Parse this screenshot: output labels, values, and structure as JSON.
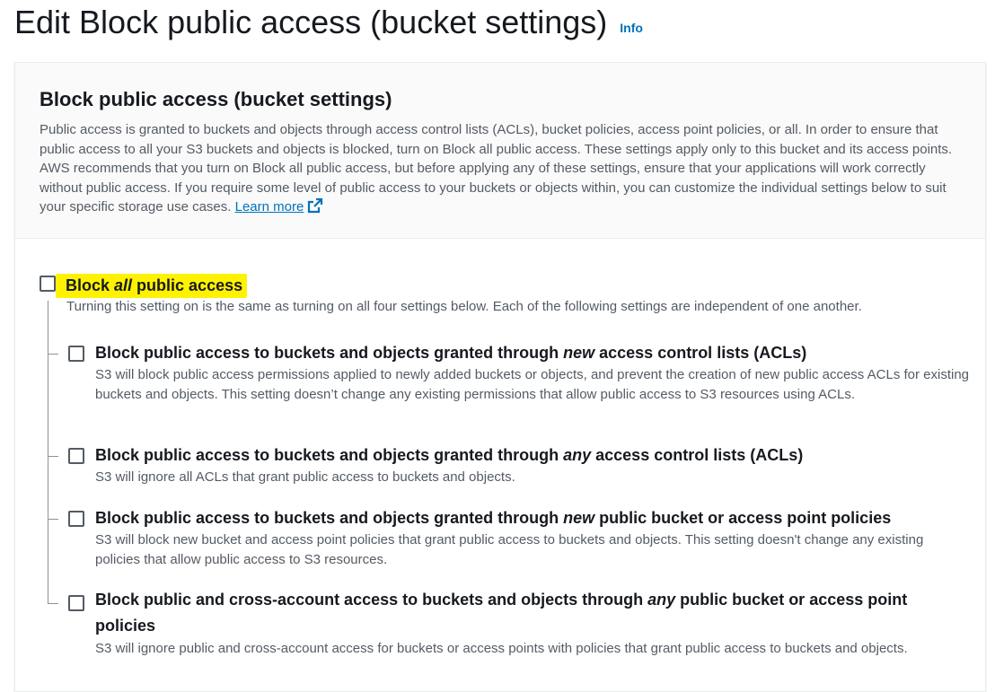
{
  "header": {
    "title": "Edit Block public access (bucket settings)",
    "info_label": "Info"
  },
  "panel": {
    "title": "Block public access (bucket settings)",
    "description": "Public access is granted to buckets and objects through access control lists (ACLs), bucket policies, access point policies, or all. In order to ensure that public access to all your S3 buckets and objects is blocked, turn on Block all public access. These settings apply only to this bucket and its access points. AWS recommends that you turn on Block all public access, but before applying any of these settings, ensure that your applications will work correctly without public access. If you require some level of public access to your buckets or objects within, you can customize the individual settings below to suit your specific storage use cases.",
    "learn_more": "Learn more"
  },
  "block_all": {
    "label_prefix": "Block ",
    "label_emph": "all",
    "label_suffix": " public access",
    "checked": false,
    "description": "Turning this setting on is the same as turning on all four settings below. Each of the following settings are independent of one another."
  },
  "options": [
    {
      "label_prefix": "Block public access to buckets and objects granted through ",
      "label_emph": "new",
      "label_suffix": " access control lists (ACLs)",
      "checked": false,
      "description": "S3 will block public access permissions applied to newly added buckets or objects, and prevent the creation of new public access ACLs for existing buckets and objects. This setting doesn’t change any existing permissions that allow public access to S3 resources using ACLs."
    },
    {
      "label_prefix": "Block public access to buckets and objects granted through ",
      "label_emph": "any",
      "label_suffix": " access control lists (ACLs)",
      "checked": false,
      "description": "S3 will ignore all ACLs that grant public access to buckets and objects."
    },
    {
      "label_prefix": "Block public access to buckets and objects granted through ",
      "label_emph": "new",
      "label_suffix": " public bucket or access point policies",
      "checked": false,
      "description": "S3 will block new bucket and access point policies that grant public access to buckets and objects. This setting doesn't change any existing policies that allow public access to S3 resources."
    },
    {
      "label_prefix": "Block public and cross-account access to buckets and objects through ",
      "label_emph": "any",
      "label_suffix": " public bucket or access point policies",
      "checked": false,
      "description": "S3 will ignore public and cross-account access for buckets or access points with policies that grant public access to buckets and objects."
    }
  ],
  "colors": {
    "highlight": "#fff200",
    "link": "#0073bb",
    "text": "#16191f",
    "muted": "#545b64"
  },
  "icons": {
    "external_link": "external-link-icon"
  }
}
